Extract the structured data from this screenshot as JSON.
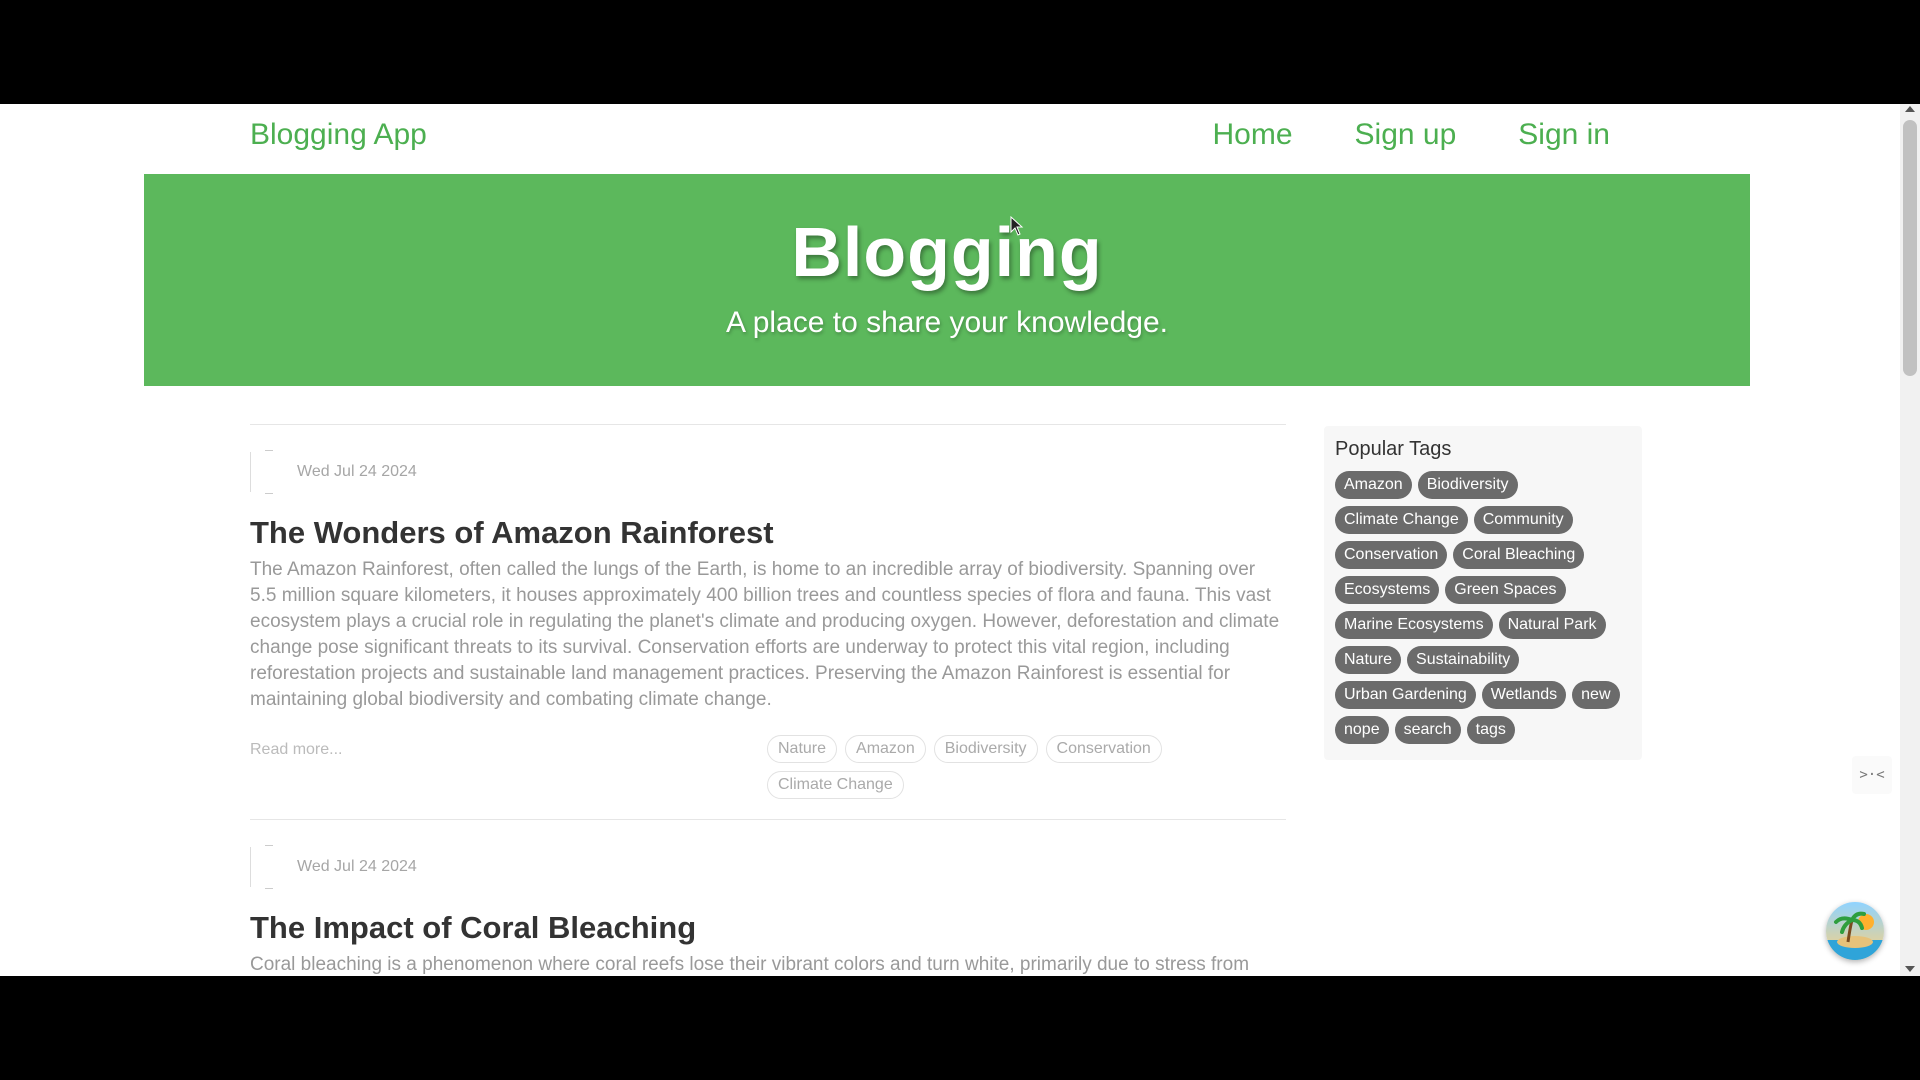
{
  "navbar": {
    "brand": "Blogging App",
    "links": [
      "Home",
      "Sign up",
      "Sign in"
    ]
  },
  "hero": {
    "title": "Blogging",
    "subtitle": "A place to share your knowledge."
  },
  "posts": [
    {
      "date": "Wed Jul 24 2024",
      "title": "The Wonders of Amazon Rainforest",
      "body": "The Amazon Rainforest, often called the lungs of the Earth, is home to an incredible array of biodiversity. Spanning over 5.5 million square kilometers, it houses approximately 400 billion trees and countless species of flora and fauna. This vast ecosystem plays a crucial role in regulating the planet's climate and producing oxygen. However, deforestation and climate change pose significant threats to its survival. Conservation efforts are underway to protect this vital region, including reforestation projects and sustainable land management practices. Preserving the Amazon Rainforest is essential for maintaining global biodiversity and combating climate change.",
      "read_more": "Read more...",
      "tags": [
        "Nature",
        "Amazon",
        "Biodiversity",
        "Conservation",
        "Climate Change"
      ]
    },
    {
      "date": "Wed Jul 24 2024",
      "title": "The Impact of Coral Bleaching",
      "body": "Coral bleaching is a phenomenon where coral reefs lose their vibrant colors and turn white, primarily due to stress from rising sea temperatures. This process occurs when corals expel the symbiotic algae living in their tissues,"
    }
  ],
  "sidebar": {
    "title": "Popular Tags",
    "tags": [
      "Amazon",
      "Biodiversity",
      "Climate Change",
      "Community",
      "Conservation",
      "Coral Bleaching",
      "Ecosystems",
      "Green Spaces",
      "Marine Ecosystems",
      "Natural Park",
      "Nature",
      "Sustainability",
      "Urban Gardening",
      "Wetlands",
      "new",
      "nope",
      "search",
      "tags"
    ]
  },
  "widgets": {
    "side_handle_glyph": ">·<",
    "fab_icon": "island-avatar-icon"
  },
  "colors": {
    "accent": "#4caf50",
    "hero_bg": "#5cb85c",
    "tag_bg": "#6b6b6b"
  }
}
